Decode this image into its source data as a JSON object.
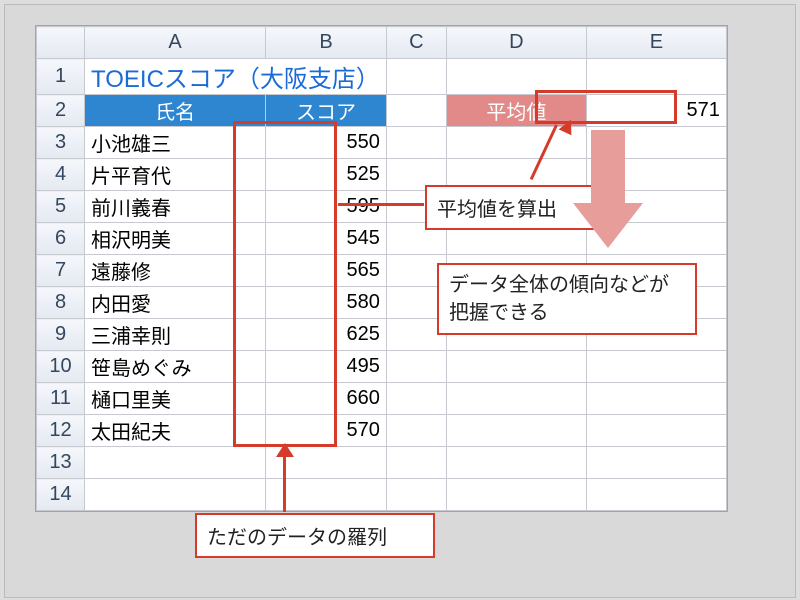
{
  "columns": [
    "A",
    "B",
    "C",
    "D",
    "E"
  ],
  "row_numbers": [
    1,
    2,
    3,
    4,
    5,
    6,
    7,
    8,
    9,
    10,
    11,
    12,
    13,
    14
  ],
  "title": "TOEICスコア（大阪支店）",
  "headers": {
    "name": "氏名",
    "score": "スコア",
    "average_label": "平均値",
    "average_value": "571"
  },
  "rows": [
    {
      "name": "小池雄三",
      "score": "550"
    },
    {
      "name": "片平育代",
      "score": "525"
    },
    {
      "name": "前川義春",
      "score": "595"
    },
    {
      "name": "相沢明美",
      "score": "545"
    },
    {
      "name": "遠藤修",
      "score": "565"
    },
    {
      "name": "内田愛",
      "score": "580"
    },
    {
      "name": "三浦幸則",
      "score": "625"
    },
    {
      "name": "笹島めぐみ",
      "score": "495"
    },
    {
      "name": "樋口里美",
      "score": "660"
    },
    {
      "name": "太田紀夫",
      "score": "570"
    }
  ],
  "callouts": {
    "avg_label": "平均値を算出",
    "trend_label": "データ全体の傾向などが把握できる",
    "list_label": "ただのデータの羅列"
  },
  "chart_data": {
    "type": "table",
    "title": "TOEICスコア（大阪支店）",
    "columns": [
      "氏名",
      "スコア"
    ],
    "records": [
      [
        "小池雄三",
        550
      ],
      [
        "片平育代",
        525
      ],
      [
        "前川義春",
        595
      ],
      [
        "相沢明美",
        545
      ],
      [
        "遠藤修",
        565
      ],
      [
        "内田愛",
        580
      ],
      [
        "三浦幸則",
        625
      ],
      [
        "笹島めぐみ",
        495
      ],
      [
        "樋口里美",
        660
      ],
      [
        "太田紀夫",
        570
      ]
    ],
    "aggregate": {
      "label": "平均値",
      "value": 571
    }
  }
}
